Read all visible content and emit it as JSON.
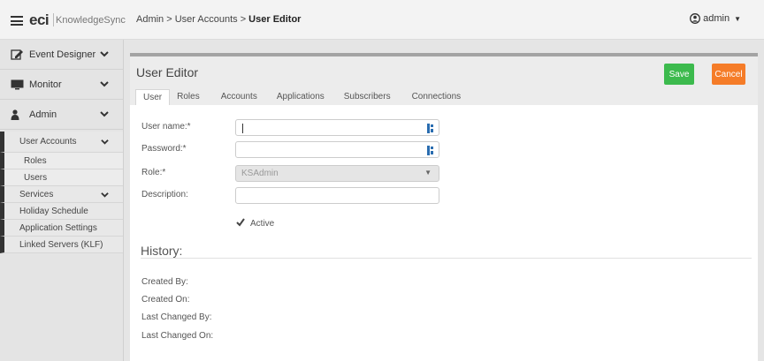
{
  "header": {
    "logo_brand": "eci",
    "logo_product": "KnowledgeSync",
    "breadcrumb_prefix": "Admin > User Accounts > ",
    "breadcrumb_current": "User Editor",
    "user_label": "admin"
  },
  "sidebar": {
    "event_designer": "Event Designer",
    "monitor": "Monitor",
    "admin": "Admin",
    "user_accounts": "User Accounts",
    "roles": "Roles",
    "users": "Users",
    "services": "Services",
    "holiday_schedule": "Holiday Schedule",
    "application_settings": "Application Settings",
    "linked_servers": "Linked Servers (KLF)"
  },
  "editor": {
    "title": "User Editor",
    "save_label": "Save",
    "cancel_label": "Cancel",
    "tabs": [
      "User",
      "Roles",
      "Accounts",
      "Applications",
      "Subscribers",
      "Connections"
    ],
    "active_tab": "User"
  },
  "form": {
    "username_label": "User name:*",
    "username_value": "",
    "password_label": "Password:*",
    "password_value": "",
    "role_label": "Role:*",
    "role_value": "KSAdmin",
    "description_label": "Description:",
    "description_value": "",
    "active_label": "Active",
    "active_checked": true
  },
  "history": {
    "title": "History:",
    "created_by": "Created By:",
    "created_on": "Created On:",
    "last_changed_by": "Last Changed By:",
    "last_changed_on": "Last Changed On:"
  },
  "colors": {
    "save": "#3cba4d",
    "cancel": "#f57c28",
    "sidebar_accent": "#333333"
  }
}
